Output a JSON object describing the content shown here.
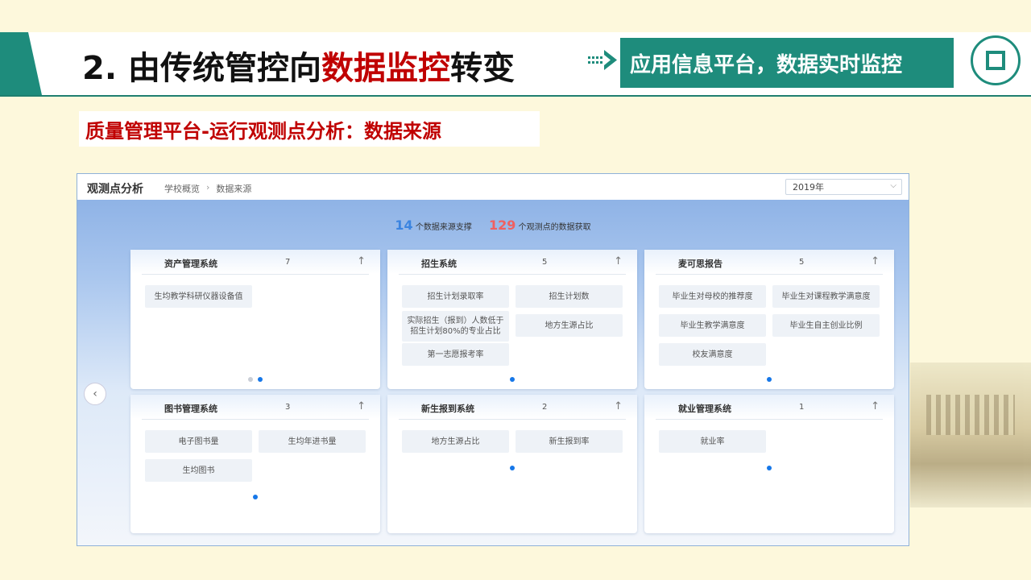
{
  "slide": {
    "title_pre": "2. 由传统管控向",
    "title_hl": "数据监控",
    "title_post": "转变",
    "tag": "应用信息平台，数据实时监控",
    "subtitle": "质量管理平台-运行观测点分析：数据来源"
  },
  "panel": {
    "title": "观测点分析",
    "breadcrumb": [
      "学校概览",
      "数据来源"
    ],
    "breadcrumb_sep": "›",
    "year": "2019年",
    "stats": {
      "sources": "14",
      "sources_label": "个数据来源支撑",
      "points": "129",
      "points_label": "个观测点的数据获取"
    },
    "cards": [
      {
        "name": "资产管理系统",
        "count": "7",
        "items": [
          "生均教学科研仪器设备值"
        ]
      },
      {
        "name": "招生系统",
        "count": "5",
        "items": [
          "招生计划录取率",
          "招生计划数",
          "实际招生（报到）人数低于招生计划80%的专业占比",
          "地方生源占比",
          "第一志愿报考率"
        ]
      },
      {
        "name": "麦可思报告",
        "count": "5",
        "items": [
          "毕业生对母校的推荐度",
          "毕业生对课程教学满意度",
          "毕业生教学满意度",
          "毕业生自主创业比例",
          "校友满意度"
        ]
      },
      {
        "name": "图书管理系统",
        "count": "3",
        "items": [
          "电子图书量",
          "生均年进书量",
          "生均图书"
        ]
      },
      {
        "name": "新生报到系统",
        "count": "2",
        "items": [
          "地方生源占比",
          "新生报到率"
        ]
      },
      {
        "name": "就业管理系统",
        "count": "1",
        "items": [
          "就业率"
        ]
      }
    ]
  },
  "icons": {
    "arrow": "double-arrow-icon",
    "up": "arrow-up-icon",
    "prev": "chevron-left-icon",
    "dropdown": "chevron-down-icon"
  },
  "colors": {
    "accent": "#1e8c7c",
    "highlight": "#c00000",
    "blue": "#3b84e0",
    "red": "#f06060"
  }
}
